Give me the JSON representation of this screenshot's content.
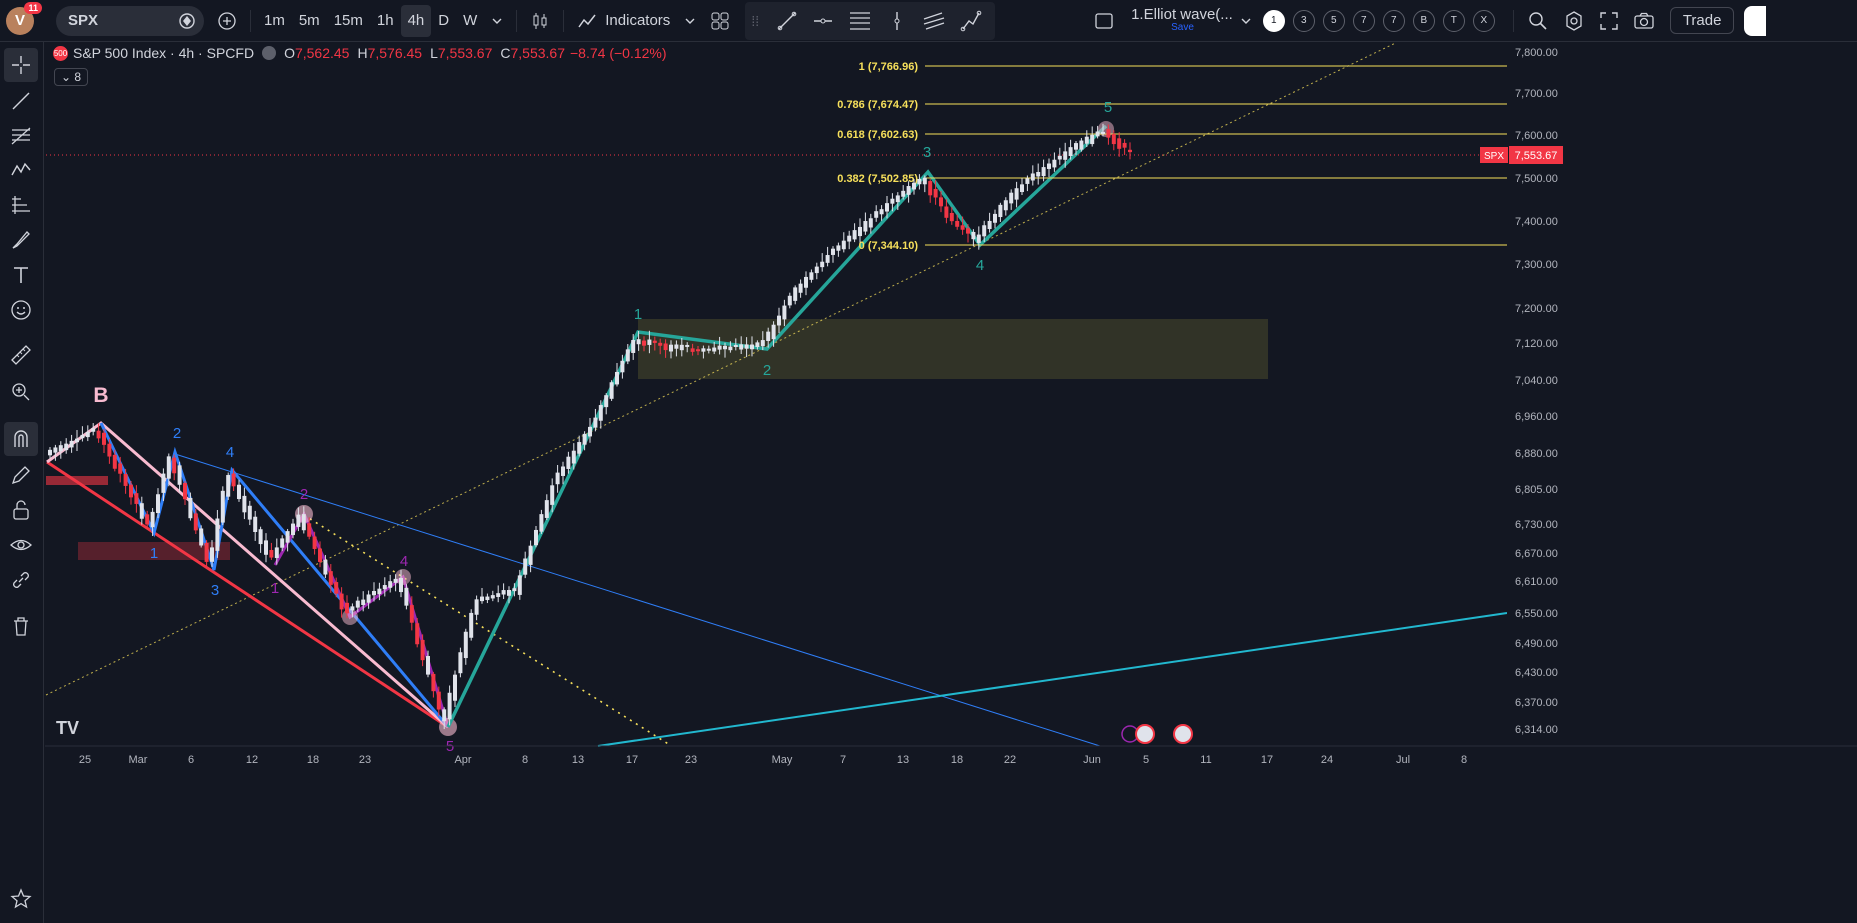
{
  "topbar": {
    "avatar_letter": "V",
    "notif_count": "11",
    "symbol": "SPX",
    "timeframes": [
      "1m",
      "5m",
      "15m",
      "1h",
      "4h",
      "D",
      "W"
    ],
    "active_timeframe": "4h",
    "indicators_label": "Indicators",
    "layout_name": "1.Elliot wave(...",
    "layout_save": "Save",
    "layout_tabs": [
      "1",
      "3",
      "5",
      "7",
      "7",
      "B",
      "T",
      "X"
    ],
    "trade_label": "Trade"
  },
  "legend": {
    "title": "S&P 500 Index · 4h · SPCFD",
    "badge": "500",
    "o_label": "O",
    "o": "7,562.45",
    "h_label": "H",
    "h": "7,576.45",
    "l_label": "L",
    "l": "7,553.67",
    "c_label": "C",
    "c": "7,553.67",
    "change": "−8.74 (−0.12%)",
    "collapse_count": "8"
  },
  "price_axis": {
    "ticks": [
      "7,800.00",
      "7,700.00",
      "7,600.00",
      "7,500.00",
      "7,400.00",
      "7,300.00",
      "7,200.00",
      "7,120.00",
      "7,040.00",
      "6,960.00",
      "6,880.00",
      "6,805.00",
      "6,730.00",
      "6,670.00",
      "6,610.00",
      "6,550.00",
      "6,490.00",
      "6,430.00",
      "6,370.00",
      "6,314.00"
    ],
    "last_symbol": "SPX",
    "last_price": "7,553.67"
  },
  "time_axis": {
    "ticks": [
      "25",
      "Mar",
      "6",
      "12",
      "18",
      "23",
      "Apr",
      "8",
      "13",
      "17",
      "23",
      "May",
      "7",
      "13",
      "18",
      "22",
      "Jun",
      "5",
      "11",
      "17",
      "24",
      "Jul",
      "8"
    ]
  },
  "fib_levels": [
    "1 (7,766.96)",
    "0.786 (7,674.47)",
    "0.618 (7,602.63)",
    "0.382 (7,502.85)",
    "0 (7,344.10)"
  ],
  "wave_labels": {
    "green": [
      "1",
      "2",
      "3",
      "4",
      "5"
    ],
    "b_label": "B",
    "blue": [
      "1",
      "2",
      "3",
      "4"
    ],
    "purple": [
      "1",
      "2",
      "4",
      "5"
    ]
  },
  "colors": {
    "background": "#131722",
    "up": "#ffffff",
    "down": "#f23645",
    "impulse_green": "#26a69a",
    "fib_yellow": "#f7e05b",
    "blue_wave": "#2f7ef7",
    "pink_wave": "#f8bbd0",
    "purple_wave": "#9c27b0",
    "cyan_line": "#22b8cf"
  }
}
